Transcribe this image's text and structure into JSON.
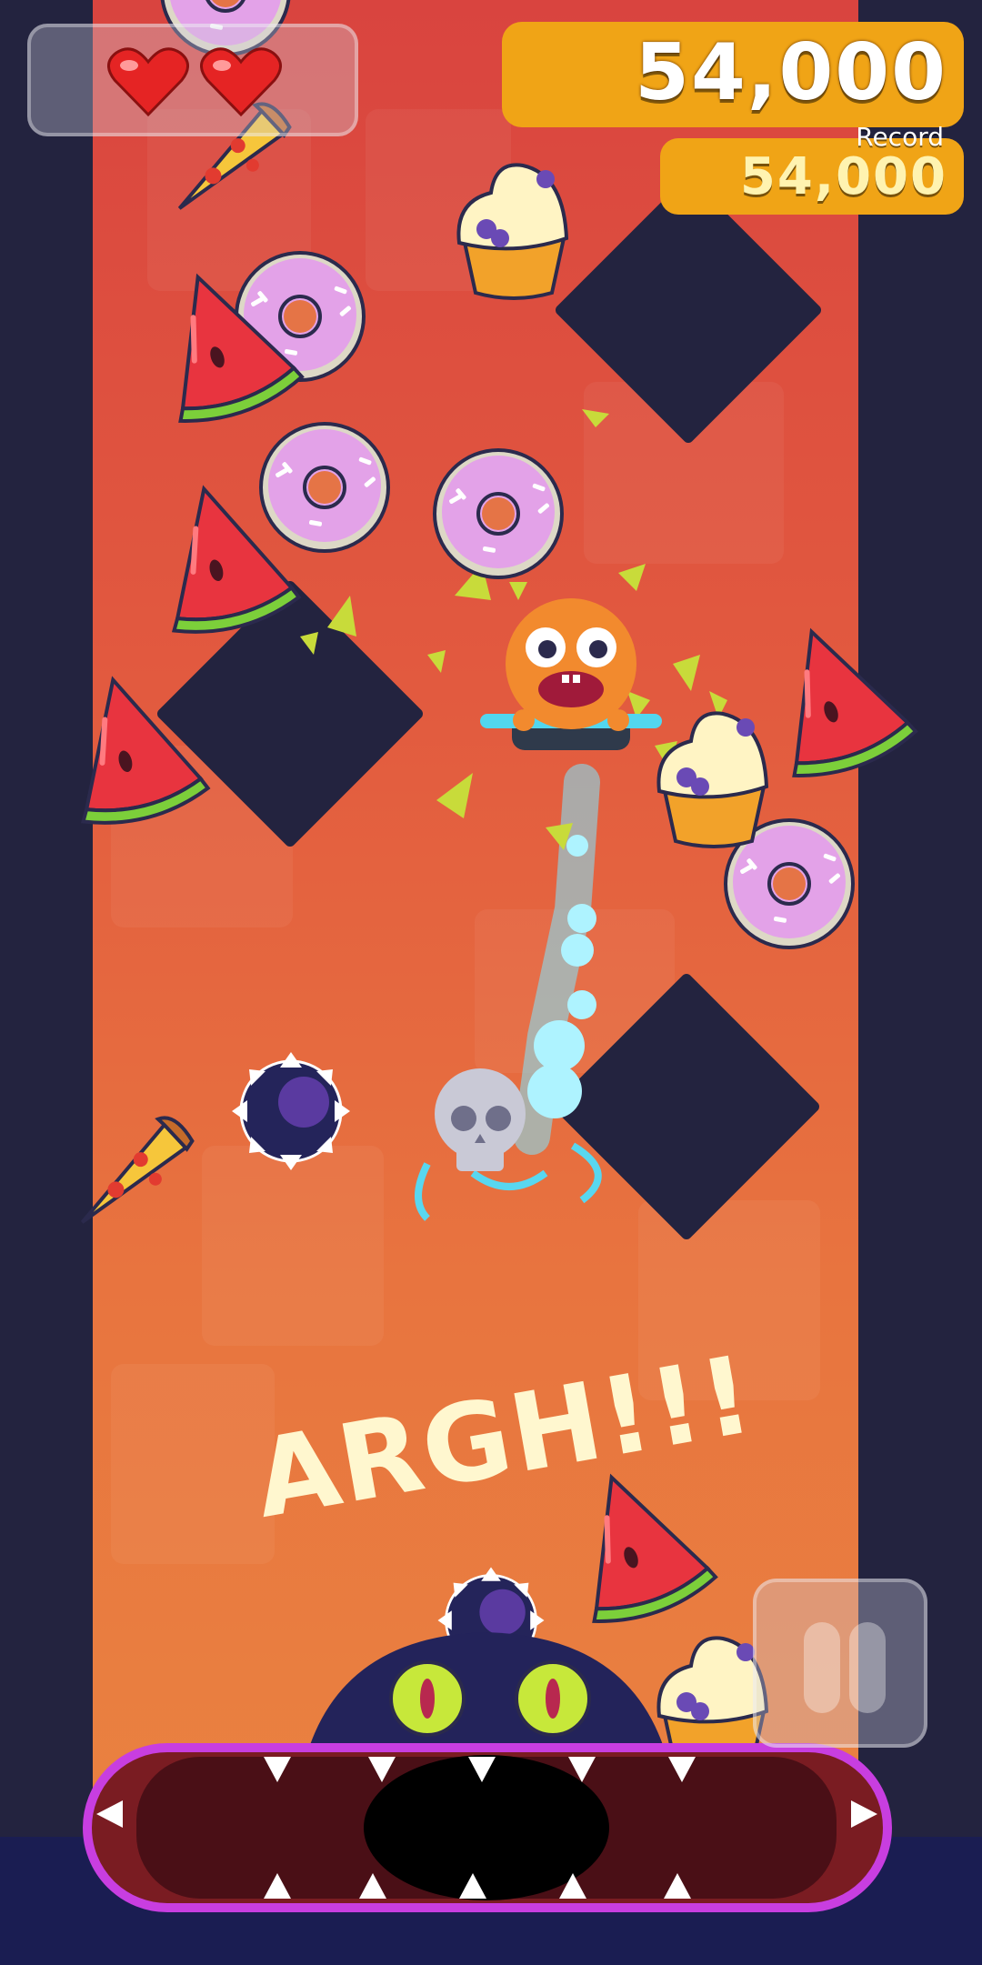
{
  "hud": {
    "lives": 2,
    "score": "54,000",
    "record_label": "Record",
    "record_value": "54,000"
  },
  "overlay": {
    "exclamation": "ARGH!!!"
  },
  "controls": {
    "pause_icon": "pause-icon"
  },
  "colors": {
    "score_panel": "#f0a416",
    "background_wall": "#23233f",
    "playfield_top": "#d9443f",
    "playfield_bottom": "#ea8540",
    "monster_mouth_border": "#c83ee0",
    "trail": "#7de8ff"
  },
  "icons": [
    "heart-icon",
    "donut-icon",
    "watermelon-icon",
    "pizza-icon",
    "cupcake-icon",
    "spike-ball-icon",
    "skull-icon",
    "pause-icon"
  ]
}
